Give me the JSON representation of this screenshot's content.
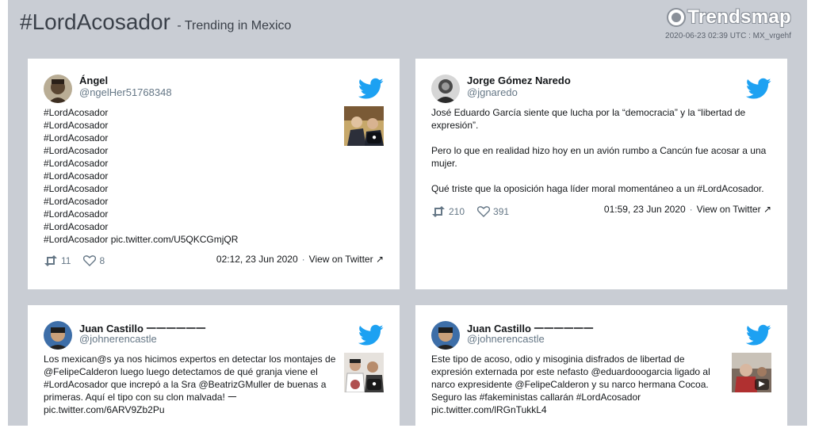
{
  "header": {
    "hashtag": "#LordAcosador",
    "suffix": "- Trending in Mexico",
    "logo_text": "Trendsmap",
    "meta": "2020-06-23 02:39 UTC : MX_vrgehf"
  },
  "colors": {
    "background": "#c9cdd4",
    "twitter_blue": "#1da1f2",
    "text": "#14171a",
    "muted": "#657786"
  },
  "tweets": [
    {
      "name": "Ángel",
      "handle": "@ngelHer51768348",
      "lines": [
        "#LordAcosador",
        "#LordAcosador",
        "#LordAcosador",
        "#LordAcosador",
        "#LordAcosador",
        "#LordAcosador",
        "#LordAcosador",
        "#LordAcosador",
        "#LordAcosador",
        "#LordAcosador",
        "#LordAcosador pic.twitter.com/U5QKCGmjQR"
      ],
      "retweets": "11",
      "likes": "8",
      "time": "02:12, 23 Jun 2020",
      "view": "View on Twitter",
      "media_icon": "camera-icon"
    },
    {
      "name": "Jorge Gómez Naredo",
      "handle": "@jgnaredo",
      "para1": "José Eduardo García siente que lucha por la “democracia” y la “libertad de expresión”.",
      "para2": "Pero lo que en realidad hizo hoy en un avión rumbo a Cancún fue acosar a una mujer.",
      "para3": "Qué triste que la oposición haga líder moral momentáneo a un #LordAcosador.",
      "retweets": "210",
      "likes": "391",
      "time": "01:59, 23 Jun 2020",
      "view": "View on Twitter"
    },
    {
      "name": "Juan Castillo 𑁋𑁋𑁋𑁋𑁋𑁋",
      "handle": "@johnerencastle",
      "text": "Los mexican@s ya nos hicimos expertos en detectar los montajes de @FelipeCalderon luego luego detectamos de qué granja viene el #LordAcosador que increpó a la Sra @BeatrizGMuller de buenas a primeras. Aquí el tipo con su clon malvada! 𑁋 pic.twitter.com/6ARV9Zb2Pu",
      "media_icon": "camera-icon"
    },
    {
      "name": "Juan Castillo 𑁋𑁋𑁋𑁋𑁋𑁋",
      "handle": "@johnerencastle",
      "text": "Este tipo de acoso, odio y misoginia disfrados de libertad de expresión externada por este nefasto @eduardooogarcia ligado al narco expresidente @FelipeCalderon y su narco hermana Cocoa. Seguro las #fakeministas callarán #LordAcosador pic.twitter.com/lRGnTukkL4",
      "media_icon": "video-icon"
    }
  ]
}
